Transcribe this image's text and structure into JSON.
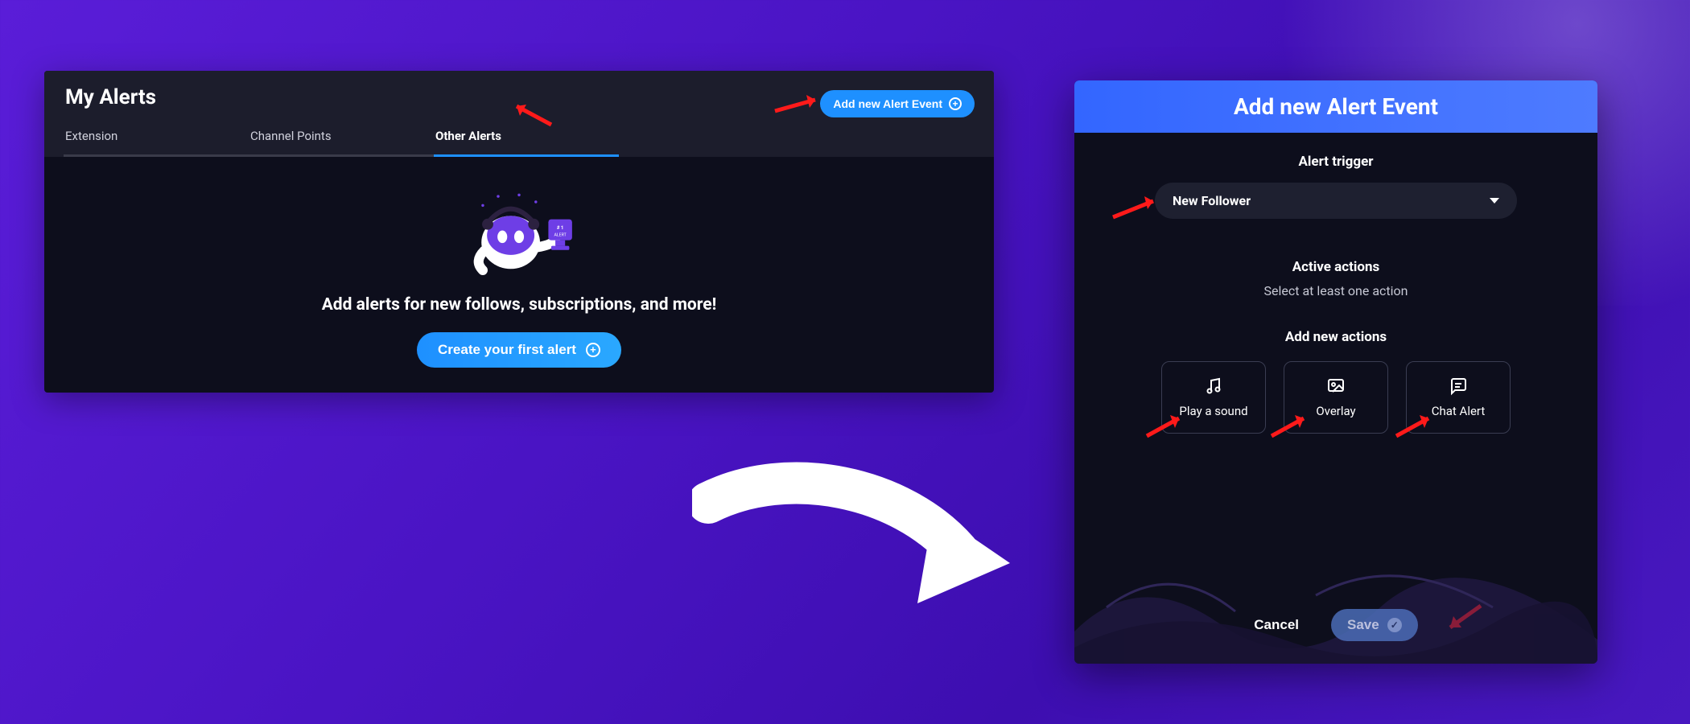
{
  "left": {
    "title": "My Alerts",
    "tabs": [
      "Extension",
      "Channel Points",
      "Other Alerts"
    ],
    "active_tab_index": 2,
    "add_button": "Add new Alert Event",
    "subtitle": "Add alerts for new follows, subscriptions, and more!",
    "cta": "Create your first alert"
  },
  "right": {
    "header": "Add new Alert Event",
    "trigger_label": "Alert trigger",
    "trigger_value": "New Follower",
    "active_actions_label": "Active actions",
    "active_actions_help": "Select at least one action",
    "add_actions_label": "Add new actions",
    "actions": [
      {
        "icon": "music-note-icon",
        "label": "Play a sound"
      },
      {
        "icon": "image-icon",
        "label": "Overlay"
      },
      {
        "icon": "chat-icon",
        "label": "Chat Alert"
      }
    ],
    "cancel": "Cancel",
    "save": "Save"
  }
}
